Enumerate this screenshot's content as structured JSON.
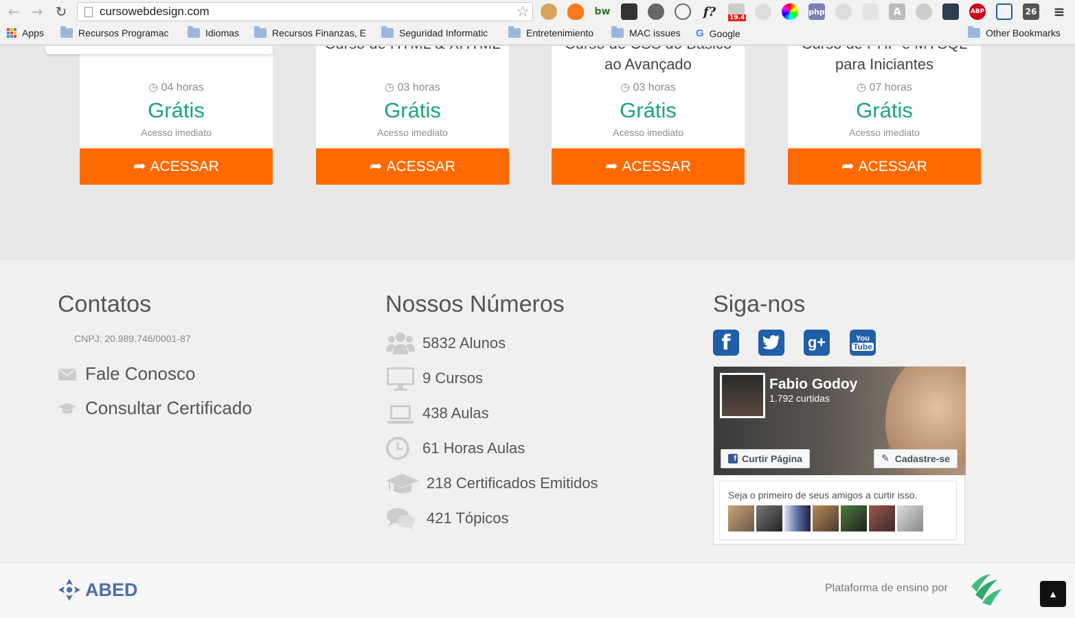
{
  "browser": {
    "url": "cursowebdesign.com",
    "bookmarks": {
      "apps": "Apps",
      "b1": "Recursos Programac",
      "b2": "Idiomas",
      "b3": "Recursos Finanzas, E",
      "b4": "Seguridad Informatic",
      "b5": "Entretenimiento",
      "b6": "MAC issues",
      "b7": "Google",
      "other": "Other Bookmarks"
    },
    "extensions": {
      "bw": "bw",
      "f": "f?",
      "badge": "19.4",
      "php": "php",
      "a": "A",
      "abp": "ABP",
      "cal": "26"
    }
  },
  "courses": [
    {
      "title_line": "",
      "hours": "04 horas",
      "price": "Grátis",
      "access": "Acesso imediato",
      "button": "ACESSAR"
    },
    {
      "title_line": "Curso de HTML & XHTML",
      "hours": "03 horas",
      "price": "Grátis",
      "access": "Acesso imediato",
      "button": "ACESSAR"
    },
    {
      "title_line": "Curso de CSS do Básico",
      "title_line2": "ao Avançado",
      "hours": "03 horas",
      "price": "Grátis",
      "access": "Acesso imediato",
      "button": "ACESSAR"
    },
    {
      "title_line": "Curso de PHP e MYSQL",
      "title_line2": "para Iniciantes",
      "hours": "07 horas",
      "price": "Grátis",
      "access": "Acesso imediato",
      "button": "ACESSAR"
    }
  ],
  "footer": {
    "contacts": {
      "title": "Contatos",
      "cnpj": "CNPJ: 20.989.746/0001-87",
      "fale": "Fale Conosco",
      "certificado": "Consultar Certificado"
    },
    "numbers": {
      "title": "Nossos Números",
      "alunos": "5832 Alunos",
      "cursos": "9 Cursos",
      "aulas": "438 Aulas",
      "horas": "61 Horas Aulas",
      "certificados": "218 Certificados Emitidos",
      "topicos": "421 Tópicos"
    },
    "social": {
      "title": "Siga-nos",
      "fb_name": "Fabio Godoy",
      "fb_likes": "1.792 curtidas",
      "fb_like_btn": "Curtir Página",
      "fb_signup_btn": "Cadastre-se",
      "fb_friends_text": "Seja o primeiro de seus amigos a curtir isso.",
      "yt_label_top": "You",
      "yt_label_bottom": "Tube"
    }
  },
  "bottom": {
    "brand": "ABED",
    "platform": "Plataforma de ensino por"
  },
  "colors": {
    "accent_orange": "#ff6a00",
    "price_green": "#1aa57c"
  }
}
